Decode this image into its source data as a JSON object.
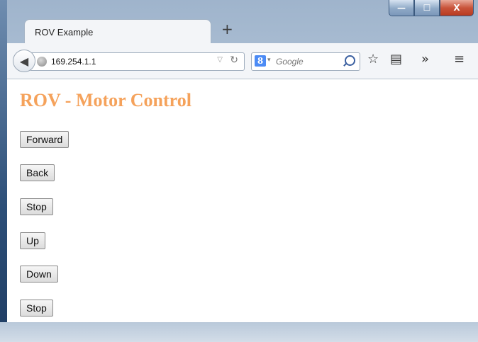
{
  "window": {
    "controls": {
      "minimize": "—",
      "maximize": "☐",
      "close": "X"
    }
  },
  "tab": {
    "title": "ROV Example",
    "new_tab_symbol": "+"
  },
  "navbar": {
    "url": "169.254.1.1",
    "search_placeholder": "Google",
    "search_engine_badge": "8",
    "icons": [
      "back-arrow-icon",
      "globe-icon",
      "reload-icon",
      "search-icon",
      "bookmark-star-icon",
      "reading-list-icon",
      "overflow-icon",
      "menu-icon"
    ]
  },
  "page": {
    "title": "ROV - Motor Control",
    "title_color": "#f5a25b",
    "buttons": [
      "Forward",
      "Back",
      "Stop",
      "Up",
      "Down",
      "Stop"
    ]
  }
}
